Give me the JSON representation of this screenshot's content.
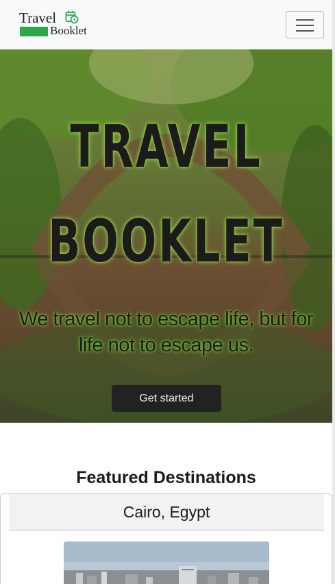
{
  "navbar": {
    "logo_top": "Travel",
    "logo_bottom": "Booklet",
    "brand_color": "#2fa84a",
    "menu_icon": "hamburger-menu-icon"
  },
  "hero": {
    "title_line1": "TRAVEL",
    "title_line2": "BOOKLET",
    "subtitle": "We travel not to escape life, but for life not to escape us.",
    "cta_label": "Get started",
    "glow_color": "#9ee04a"
  },
  "featured": {
    "heading": "Featured Destinations",
    "cards": [
      {
        "title": "Cairo, Egypt"
      }
    ]
  }
}
